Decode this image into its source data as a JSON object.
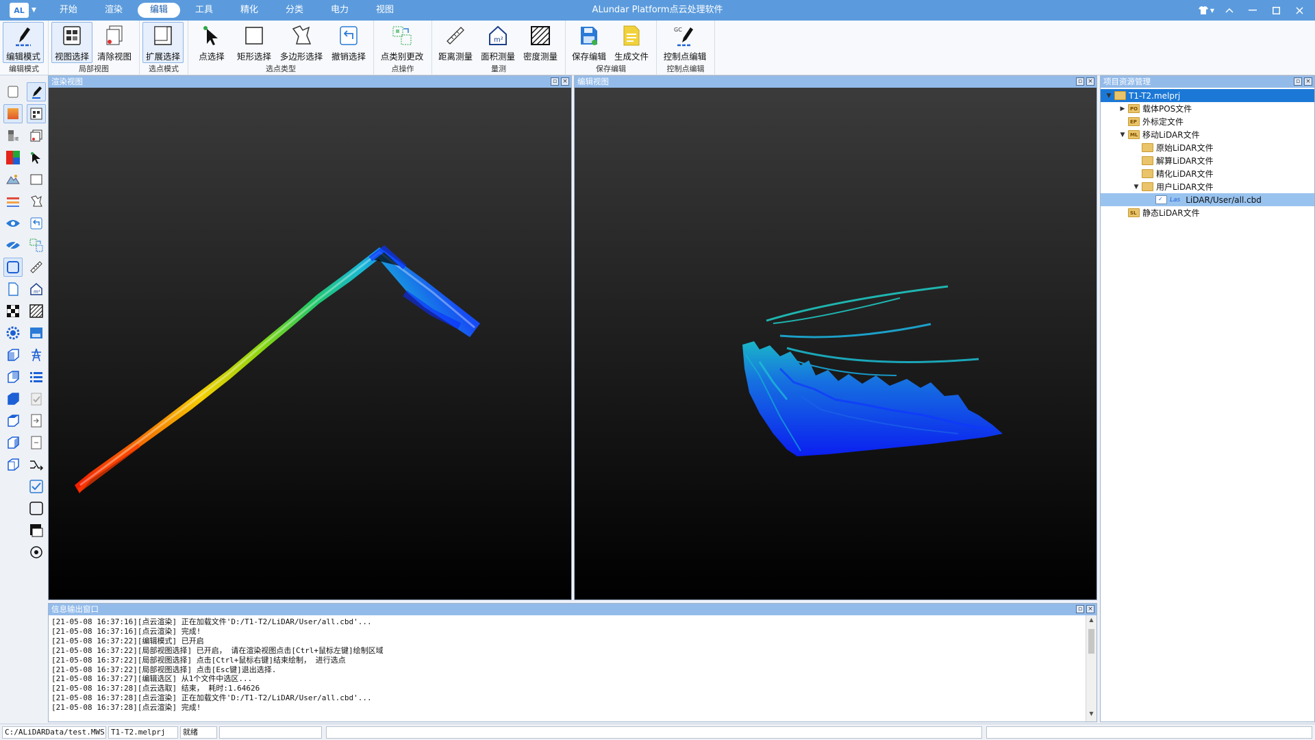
{
  "app": {
    "logo": "AL",
    "title": "ALundar Platform点云处理软件"
  },
  "menu": {
    "tabs": [
      "开始",
      "渲染",
      "编辑",
      "工具",
      "精化",
      "分类",
      "电力",
      "视图"
    ],
    "active_index": 2
  },
  "ribbon": {
    "groups": [
      {
        "label": "编辑模式",
        "buttons": [
          {
            "label": "编辑模式",
            "icon": "pen-icon",
            "selected": true
          }
        ]
      },
      {
        "label": "局部视图",
        "buttons": [
          {
            "label": "视图选择",
            "icon": "view-select-icon",
            "selected": true
          },
          {
            "label": "清除视图",
            "icon": "clear-view-icon",
            "selected": false
          }
        ]
      },
      {
        "label": "选点模式",
        "buttons": [
          {
            "label": "扩展选择",
            "icon": "extend-select-icon",
            "selected": true
          }
        ]
      },
      {
        "label": "选点类型",
        "buttons": [
          {
            "label": "点选择",
            "icon": "cursor-icon",
            "selected": false
          },
          {
            "label": "矩形选择",
            "icon": "rectangle-icon",
            "selected": false
          },
          {
            "label": "多边形选择",
            "icon": "polygon-icon",
            "selected": false
          },
          {
            "label": "撤销选择",
            "icon": "undo-icon",
            "selected": false
          }
        ]
      },
      {
        "label": "点操作",
        "buttons": [
          {
            "label": "点类别更改",
            "icon": "class-change-icon",
            "selected": false
          }
        ]
      },
      {
        "label": "量测",
        "buttons": [
          {
            "label": "距离测量",
            "icon": "ruler-icon",
            "selected": false
          },
          {
            "label": "面积测量",
            "icon": "area-icon",
            "selected": false
          },
          {
            "label": "密度测量",
            "icon": "density-icon",
            "selected": false
          }
        ]
      },
      {
        "label": "保存编辑",
        "buttons": [
          {
            "label": "保存编辑",
            "icon": "save-edit-icon",
            "selected": false
          },
          {
            "label": "生成文件",
            "icon": "generate-file-icon",
            "selected": false
          }
        ]
      },
      {
        "label": "控制点编辑",
        "buttons": [
          {
            "label": "控制点编辑",
            "icon": "control-point-icon",
            "selected": false
          }
        ]
      }
    ]
  },
  "panels": {
    "render_view": "渲染视图",
    "edit_view": "编辑视图",
    "project": "项目资源管理",
    "log": "信息输出窗口"
  },
  "tree": [
    {
      "label": "T1-T2.melprj",
      "level": 0,
      "twisty": "▼",
      "tag": "",
      "selected": "dark"
    },
    {
      "label": "载体POS文件",
      "level": 1,
      "twisty": "▶",
      "tag": "PO",
      "selected": ""
    },
    {
      "label": "外标定文件",
      "level": 1,
      "twisty": "",
      "tag": "EP",
      "selected": ""
    },
    {
      "label": "移动LiDAR文件",
      "level": 1,
      "twisty": "▼",
      "tag": "ML",
      "selected": ""
    },
    {
      "label": "原始LiDAR文件",
      "level": 2,
      "twisty": "",
      "tag": "",
      "selected": ""
    },
    {
      "label": "解算LiDAR文件",
      "level": 2,
      "twisty": "",
      "tag": "",
      "selected": ""
    },
    {
      "label": "精化LiDAR文件",
      "level": 2,
      "twisty": "",
      "tag": "",
      "selected": ""
    },
    {
      "label": "用户LiDAR文件",
      "level": 2,
      "twisty": "▼",
      "tag": "",
      "selected": ""
    },
    {
      "label": "LiDAR/User/all.cbd",
      "level": 3,
      "twisty": "",
      "tag": "Las",
      "selected": "light"
    },
    {
      "label": "静态LiDAR文件",
      "level": 1,
      "twisty": "",
      "tag": "SL",
      "selected": ""
    }
  ],
  "log": [
    "[21-05-08 16:37:16][点云渲染] 正在加载文件'D:/T1-T2/LiDAR/User/all.cbd'...",
    "[21-05-08 16:37:16][点云渲染] 完成!",
    "[21-05-08 16:37:22][编辑模式] 已开启",
    "[21-05-08 16:37:22][局部视图选择] 已开启， 请在渲染视图点击[Ctrl+鼠标左键]绘制区域",
    "[21-05-08 16:37:22][局部视图选择] 点击[Ctrl+鼠标右键]结束绘制， 进行选点",
    "[21-05-08 16:37:22][局部视图选择] 点击[Esc键]退出选择.",
    "[21-05-08 16:37:27][编辑选区] 从1个文件中选区...",
    "[21-05-08 16:37:28][点云选取] 结束， 耗时:1.64626",
    "[21-05-08 16:37:28][点云渲染] 正在加载文件'D:/T1-T2/LiDAR/User/all.cbd'...",
    "[21-05-08 16:37:28][点云渲染] 完成!"
  ],
  "status": {
    "path": "C:/ALiDARData/test.MWS",
    "project": "T1-T2.melprj",
    "state": "就绪"
  },
  "colors": {
    "titlebar": "#5b9bdd",
    "panel_header": "#93bbea",
    "selection": "#1b78d6"
  }
}
